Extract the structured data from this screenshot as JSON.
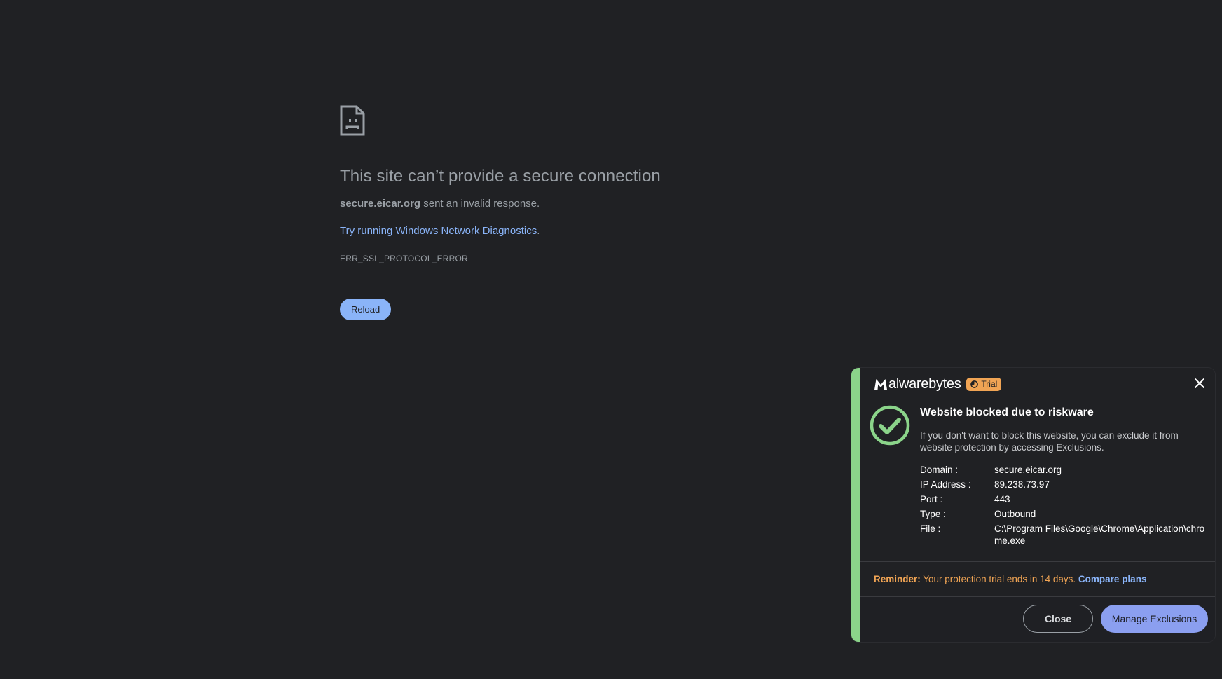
{
  "error": {
    "title": "This site can’t provide a secure connection",
    "domain": "secure.eicar.org",
    "desc_suffix": " sent an invalid response.",
    "link_text": "Try running Windows Network Diagnostics",
    "link_suffix": ".",
    "code": "ERR_SSL_PROTOCOL_ERROR",
    "reload_label": "Reload"
  },
  "malwarebytes": {
    "brand": "alwarebytes",
    "trial_label": "Trial",
    "title": "Website blocked due to riskware",
    "message": "If you don't want to block this website, you can exclude it from website protection by accessing Exclusions.",
    "details": [
      {
        "label": "Domain :",
        "value": "secure.eicar.org"
      },
      {
        "label": "IP Address :",
        "value": "89.238.73.97"
      },
      {
        "label": "Port :",
        "value": "443"
      },
      {
        "label": "Type :",
        "value": "Outbound"
      },
      {
        "label": "File :",
        "value": "C:\\Program Files\\Google\\Chrome\\Application\\chrome.exe"
      }
    ],
    "reminder_label": "Reminder:",
    "reminder_text": " Your protection trial ends in 14 days. ",
    "compare_label": "Compare plans",
    "close_label": "Close",
    "manage_label": "Manage Exclusions",
    "colors": {
      "stripe": "#8bd48a",
      "trial_badge": "#f0a454",
      "primary_button": "#8b9ff0",
      "link": "#8ab4f8"
    }
  }
}
